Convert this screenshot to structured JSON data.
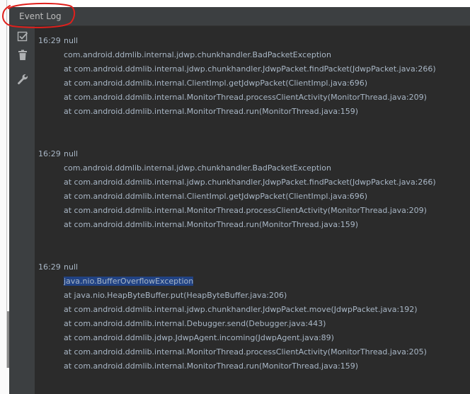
{
  "panel": {
    "title": "Event Log"
  },
  "toolbar": {
    "tools": [
      {
        "icon": "mark-read-icon"
      },
      {
        "icon": "trash-icon"
      },
      {
        "icon": "wrench-icon"
      }
    ]
  },
  "colors": {
    "background": "#2b2b2b",
    "header": "#3c3f41",
    "text": "#a9b7c6",
    "selection": "#214283",
    "annotation": "#e0201c"
  },
  "entries": [
    {
      "time": "16:29",
      "lines": [
        "null",
        "com.android.ddmlib.internal.jdwp.chunkhandler.BadPacketException",
        "at com.android.ddmlib.internal.jdwp.chunkhandler.JdwpPacket.findPacket(JdwpPacket.java:266)",
        "at com.android.ddmlib.internal.ClientImpl.getJdwpPacket(ClientImpl.java:696)",
        "at com.android.ddmlib.internal.MonitorThread.processClientActivity(MonitorThread.java:209)",
        "at com.android.ddmlib.internal.MonitorThread.run(MonitorThread.java:159)"
      ]
    },
    {
      "time": "16:29",
      "lines": [
        "null",
        "com.android.ddmlib.internal.jdwp.chunkhandler.BadPacketException",
        "at com.android.ddmlib.internal.jdwp.chunkhandler.JdwpPacket.findPacket(JdwpPacket.java:266)",
        "at com.android.ddmlib.internal.ClientImpl.getJdwpPacket(ClientImpl.java:696)",
        "at com.android.ddmlib.internal.MonitorThread.processClientActivity(MonitorThread.java:209)",
        "at com.android.ddmlib.internal.MonitorThread.run(MonitorThread.java:159)"
      ]
    },
    {
      "time": "16:29",
      "lines": [
        "null",
        "java.nio.BufferOverflowException",
        "at java.nio.HeapByteBuffer.put(HeapByteBuffer.java:206)",
        "at com.android.ddmlib.internal.jdwp.chunkhandler.JdwpPacket.move(JdwpPacket.java:192)",
        "at com.android.ddmlib.internal.Debugger.send(Debugger.java:443)",
        "at com.android.ddmlib.jdwp.JdwpAgent.incoming(JdwpAgent.java:89)",
        "at com.android.ddmlib.internal.MonitorThread.processClientActivity(MonitorThread.java:205)",
        "at com.android.ddmlib.internal.MonitorThread.run(MonitorThread.java:159)"
      ],
      "selected_line": "java.nio.BufferOverflowException"
    }
  ]
}
